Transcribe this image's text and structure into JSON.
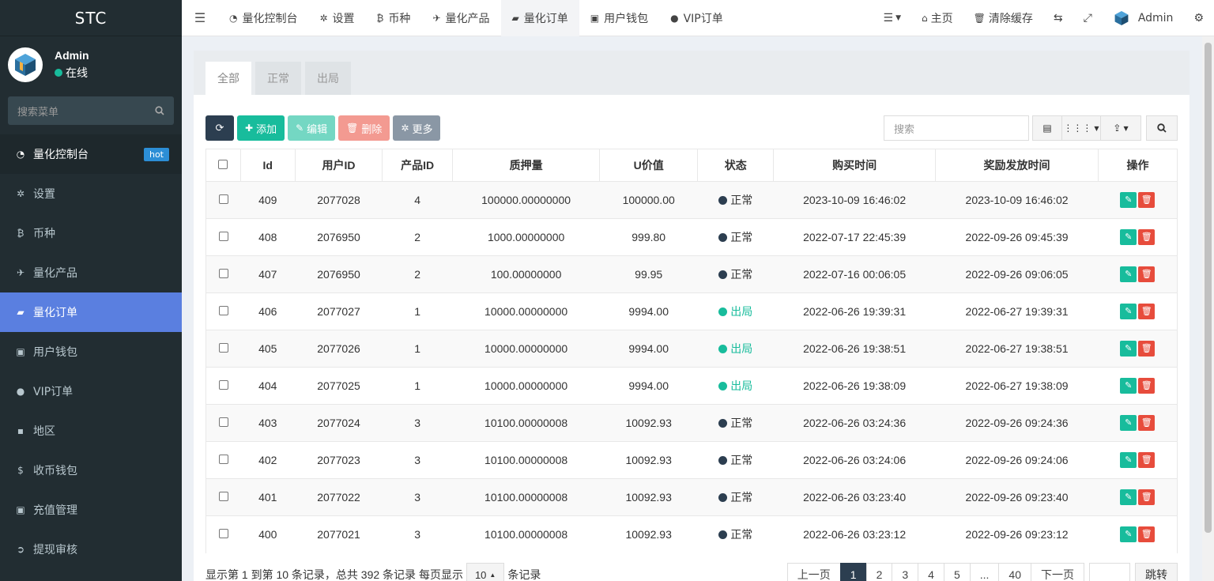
{
  "sidebar": {
    "brand": "STC",
    "user_name": "Admin",
    "user_status": "在线",
    "search_placeholder": "搜索菜单",
    "hot_badge": "hot",
    "items": [
      {
        "label": "量化控制台",
        "icon": "dashboard-icon"
      },
      {
        "label": "设置",
        "icon": "gear-icon"
      },
      {
        "label": "币种",
        "icon": "bitcoin-icon"
      },
      {
        "label": "量化产品",
        "icon": "plane-icon"
      },
      {
        "label": "量化订单",
        "icon": "book-icon"
      },
      {
        "label": "用户钱包",
        "icon": "money-icon"
      },
      {
        "label": "VIP订单",
        "icon": "circle-icon"
      },
      {
        "label": "地区",
        "icon": "phone-icon"
      },
      {
        "label": "收币钱包",
        "icon": "dollar-icon"
      },
      {
        "label": "充值管理",
        "icon": "money-icon"
      },
      {
        "label": "提现审核",
        "icon": "arrow-circle-icon"
      }
    ]
  },
  "topnav": {
    "tabs": [
      "量化控制台",
      "设置",
      "币种",
      "量化产品",
      "量化订单",
      "用户钱包",
      "VIP订单"
    ],
    "home": "主页",
    "clear_cache": "清除缓存",
    "admin": "Admin"
  },
  "content": {
    "tabs": [
      "全部",
      "正常",
      "出局"
    ],
    "toolbar": {
      "add": "添加",
      "edit": "编辑",
      "delete": "删除",
      "more": "更多",
      "search_placeholder": "搜索"
    },
    "table": {
      "headers": [
        "Id",
        "用户ID",
        "产品ID",
        "质押量",
        "U价值",
        "状态",
        "购买时间",
        "奖励发放时间",
        "操作"
      ],
      "rows": [
        {
          "id": "409",
          "uid": "2077028",
          "pid": "4",
          "qty": "100000.00000000",
          "uval": "100000.00",
          "status": "正常",
          "buy": "2023-10-09 16:46:02",
          "reward": "2023-10-09 16:46:02"
        },
        {
          "id": "408",
          "uid": "2076950",
          "pid": "2",
          "qty": "1000.00000000",
          "uval": "999.80",
          "status": "正常",
          "buy": "2022-07-17 22:45:39",
          "reward": "2022-09-26 09:45:39"
        },
        {
          "id": "407",
          "uid": "2076950",
          "pid": "2",
          "qty": "100.00000000",
          "uval": "99.95",
          "status": "正常",
          "buy": "2022-07-16 00:06:05",
          "reward": "2022-09-26 09:06:05"
        },
        {
          "id": "406",
          "uid": "2077027",
          "pid": "1",
          "qty": "10000.00000000",
          "uval": "9994.00",
          "status": "出局",
          "buy": "2022-06-26 19:39:31",
          "reward": "2022-06-27 19:39:31"
        },
        {
          "id": "405",
          "uid": "2077026",
          "pid": "1",
          "qty": "10000.00000000",
          "uval": "9994.00",
          "status": "出局",
          "buy": "2022-06-26 19:38:51",
          "reward": "2022-06-27 19:38:51"
        },
        {
          "id": "404",
          "uid": "2077025",
          "pid": "1",
          "qty": "10000.00000000",
          "uval": "9994.00",
          "status": "出局",
          "buy": "2022-06-26 19:38:09",
          "reward": "2022-06-27 19:38:09"
        },
        {
          "id": "403",
          "uid": "2077024",
          "pid": "3",
          "qty": "10100.00000008",
          "uval": "10092.93",
          "status": "正常",
          "buy": "2022-06-26 03:24:36",
          "reward": "2022-09-26 09:24:36"
        },
        {
          "id": "402",
          "uid": "2077023",
          "pid": "3",
          "qty": "10100.00000008",
          "uval": "10092.93",
          "status": "正常",
          "buy": "2022-06-26 03:24:06",
          "reward": "2022-09-26 09:24:06"
        },
        {
          "id": "401",
          "uid": "2077022",
          "pid": "3",
          "qty": "10100.00000008",
          "uval": "10092.93",
          "status": "正常",
          "buy": "2022-06-26 03:23:40",
          "reward": "2022-09-26 09:23:40"
        },
        {
          "id": "400",
          "uid": "2077021",
          "pid": "3",
          "qty": "10100.00000008",
          "uval": "10092.93",
          "status": "正常",
          "buy": "2022-06-26 03:23:12",
          "reward": "2022-09-26 09:23:12"
        }
      ]
    },
    "footer": {
      "summary": "显示第 1 到第 10 条记录，总共 392 条记录 每页显示",
      "page_size": "10",
      "suffix": "条记录",
      "prev": "上一页",
      "next": "下一页",
      "pages": [
        "1",
        "2",
        "3",
        "4",
        "5",
        "...",
        "40"
      ],
      "jump": "跳转"
    }
  },
  "colors": {
    "sidebar_bg": "#222d32",
    "active_menu": "#5a7fe0",
    "green": "#18bc9c",
    "red": "#e74c3c",
    "dark": "#2c3e50"
  }
}
